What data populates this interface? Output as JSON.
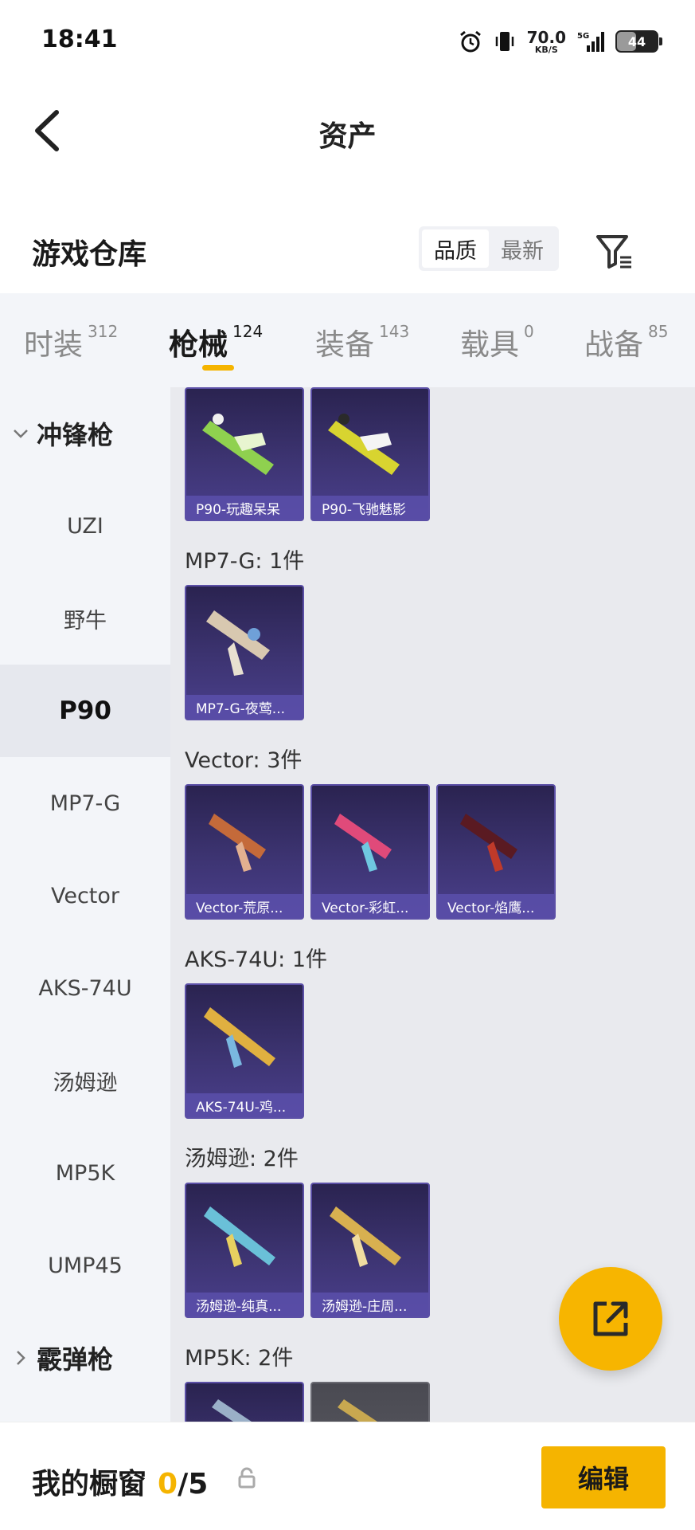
{
  "status_bar": {
    "time": "18:41",
    "net_speed": "70.0",
    "net_unit": "KB/S",
    "signal_label": "5G",
    "battery": "44"
  },
  "nav": {
    "title": "资产"
  },
  "header": {
    "section_title": "游戏仓库",
    "sort_options": [
      "品质",
      "最新"
    ],
    "active_sort": "品质"
  },
  "tabs": [
    {
      "label": "时装",
      "count": "312"
    },
    {
      "label": "枪械",
      "count": "124"
    },
    {
      "label": "装备",
      "count": "143"
    },
    {
      "label": "载具",
      "count": "0"
    },
    {
      "label": "战备",
      "count": "85"
    }
  ],
  "active_tab": "枪械",
  "sidebar": {
    "group_smg": "冲锋枪",
    "items": [
      "UZI",
      "野牛",
      "P90",
      "MP7-G",
      "Vector",
      "AKS-74U",
      "汤姆逊",
      "MP5K",
      "UMP45"
    ],
    "active_item": "P90",
    "group_shotgun": "霰弹枪"
  },
  "content": {
    "p90_items": [
      "P90-玩趣呆呆",
      "P90-飞驰魅影"
    ],
    "groups": [
      {
        "label": "MP7-G: 1件",
        "items": [
          "MP7-G-夜莺..."
        ]
      },
      {
        "label": "Vector: 3件",
        "items": [
          "Vector-荒原...",
          "Vector-彩虹...",
          "Vector-焰鹰..."
        ]
      },
      {
        "label": "AKS-74U: 1件",
        "items": [
          "AKS-74U-鸡..."
        ]
      },
      {
        "label": "汤姆逊: 2件",
        "items": [
          "汤姆逊-纯真...",
          "汤姆逊-庄周..."
        ]
      },
      {
        "label": "MP5K: 2件",
        "items": [
          "",
          ""
        ]
      }
    ]
  },
  "bottom": {
    "showcase_label": "我的橱窗",
    "showcase_current": "0",
    "showcase_total": "/5",
    "edit_label": "编辑"
  },
  "colors": {
    "accent": "#f5b400",
    "card_bg": "#3d3472",
    "card_caption": "#5a4eaa",
    "sidebar_bg": "#f3f5f9",
    "content_bg": "#e9eaee"
  },
  "icons": [
    "back-arrow-icon",
    "filter-icon",
    "chevron-down-icon",
    "chevron-right-icon",
    "share-export-icon",
    "lock-icon",
    "alarm-icon",
    "vibrate-icon",
    "signal-icon",
    "battery-icon"
  ]
}
